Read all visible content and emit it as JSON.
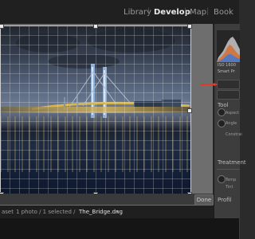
{
  "app": {
    "modules": [
      {
        "label": "Library",
        "active": false
      },
      {
        "label": "Develop",
        "active": true
      },
      {
        "label": "Map",
        "active": false
      },
      {
        "label": "Book",
        "active": false
      }
    ]
  },
  "panel": {
    "iso_label": "ISO 1600",
    "smart_preview_label": "Smart Pr",
    "tool_label": "Tool",
    "aspect_label": "Aspect",
    "angle_label": "Angle",
    "constrain_label": "Constrai",
    "treatment_label": "Treatment",
    "temp_label": "Temp",
    "tint_label": "Tint",
    "profile_label": "Profil"
  },
  "status": {
    "prefix": "aset",
    "count_text": "1 photo / 1 selected /",
    "filename": "The_Bridge.dng",
    "dropdown_glyph": "▾"
  },
  "toolbar": {
    "done_label": "Done"
  },
  "colors": {
    "accent_red": "#e03a2a",
    "active_module": "#e8e8e8",
    "inactive_module": "#9a9a9a"
  }
}
